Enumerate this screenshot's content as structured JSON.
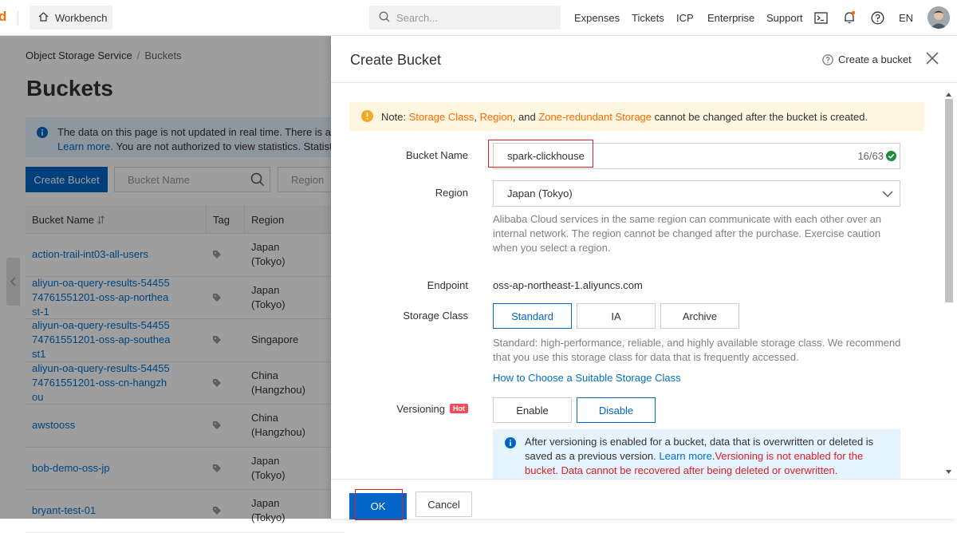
{
  "topbar": {
    "logo": "d",
    "workbench_label": "Workbench",
    "search_placeholder": "Search...",
    "nav": [
      "Expenses",
      "Tickets",
      "ICP",
      "Enterprise",
      "Support"
    ],
    "lang": "EN"
  },
  "background": {
    "breadcrumb": [
      "Object Storage Service",
      "Buckets"
    ],
    "breadcrumb_sep": "/",
    "title": "Buckets",
    "notice_line1": "The data on this page is not updated in real time. There is a l",
    "notice_line2_link": "Learn more.",
    "notice_line2_rest": " You are not authorized to view statistics. Statisti",
    "create_bucket_button": "Create Bucket",
    "bucket_name_placeholder": "Bucket Name",
    "region_placeholder": "Region",
    "table": {
      "headers": [
        "Bucket Name",
        "Tag",
        "Region"
      ],
      "rows": [
        {
          "name": "action-trail-int03-all-users",
          "region": "Japan\n(Tokyo)"
        },
        {
          "name": "aliyun-oa-query-results-5445574761551201-oss-ap-northeast-1",
          "region": "Japan\n(Tokyo)"
        },
        {
          "name": "aliyun-oa-query-results-5445574761551201-oss-ap-southeast1",
          "region": "Singapore"
        },
        {
          "name": "aliyun-oa-query-results-5445574761551201-oss-cn-hangzhou",
          "region": "China\n(Hangzhou)"
        },
        {
          "name": "awstooss",
          "region": "China\n(Hangzhou)"
        },
        {
          "name": "bob-demo-oss-jp",
          "region": "Japan\n(Tokyo)"
        },
        {
          "name": "bryant-test-01",
          "region": "Japan\n(Tokyo)"
        }
      ]
    }
  },
  "drawer": {
    "title": "Create Bucket",
    "help_link": "Create a bucket",
    "warning": {
      "prefix": "Note: ",
      "storage_class": "Storage Class",
      "comma1": ", ",
      "region": "Region",
      "and": ", and ",
      "zone": "Zone-redundant Storage",
      "suffix": " cannot be changed after the bucket is created."
    },
    "bucket_name": {
      "label": "Bucket Name",
      "value": "spark-clickhouse",
      "count": "16/63"
    },
    "region": {
      "label": "Region",
      "value": "Japan (Tokyo)",
      "help": "Alibaba Cloud services in the same region can communicate with each other over an internal network. The region cannot be changed after the purchase. Exercise caution when you select a region."
    },
    "endpoint": {
      "label": "Endpoint",
      "value": "oss-ap-northeast-1.aliyuncs.com"
    },
    "storage_class": {
      "label": "Storage Class",
      "options": [
        "Standard",
        "IA",
        "Archive"
      ],
      "selected": "Standard",
      "help": "Standard: high-performance, reliable, and highly available storage class. We recommend that you use this storage class for data that is frequently accessed.",
      "link": "How to Choose a Suitable Storage Class"
    },
    "versioning": {
      "label": "Versioning",
      "badge": "Hot",
      "options": [
        "Enable",
        "Disable"
      ],
      "selected": "Disable",
      "info_text": "After versioning is enabled for a bucket, data that is overwritten or deleted is saved as a previous version. ",
      "info_link": "Learn more.",
      "info_red": "Versioning is not enabled for the bucket. Data cannot be recovered after being deleted or overwritten."
    },
    "footer": {
      "ok": "OK",
      "cancel": "Cancel"
    }
  },
  "colors": {
    "primary": "#0064c8",
    "brand_orange": "#ff6a00",
    "highlight_red": "#e02020"
  }
}
